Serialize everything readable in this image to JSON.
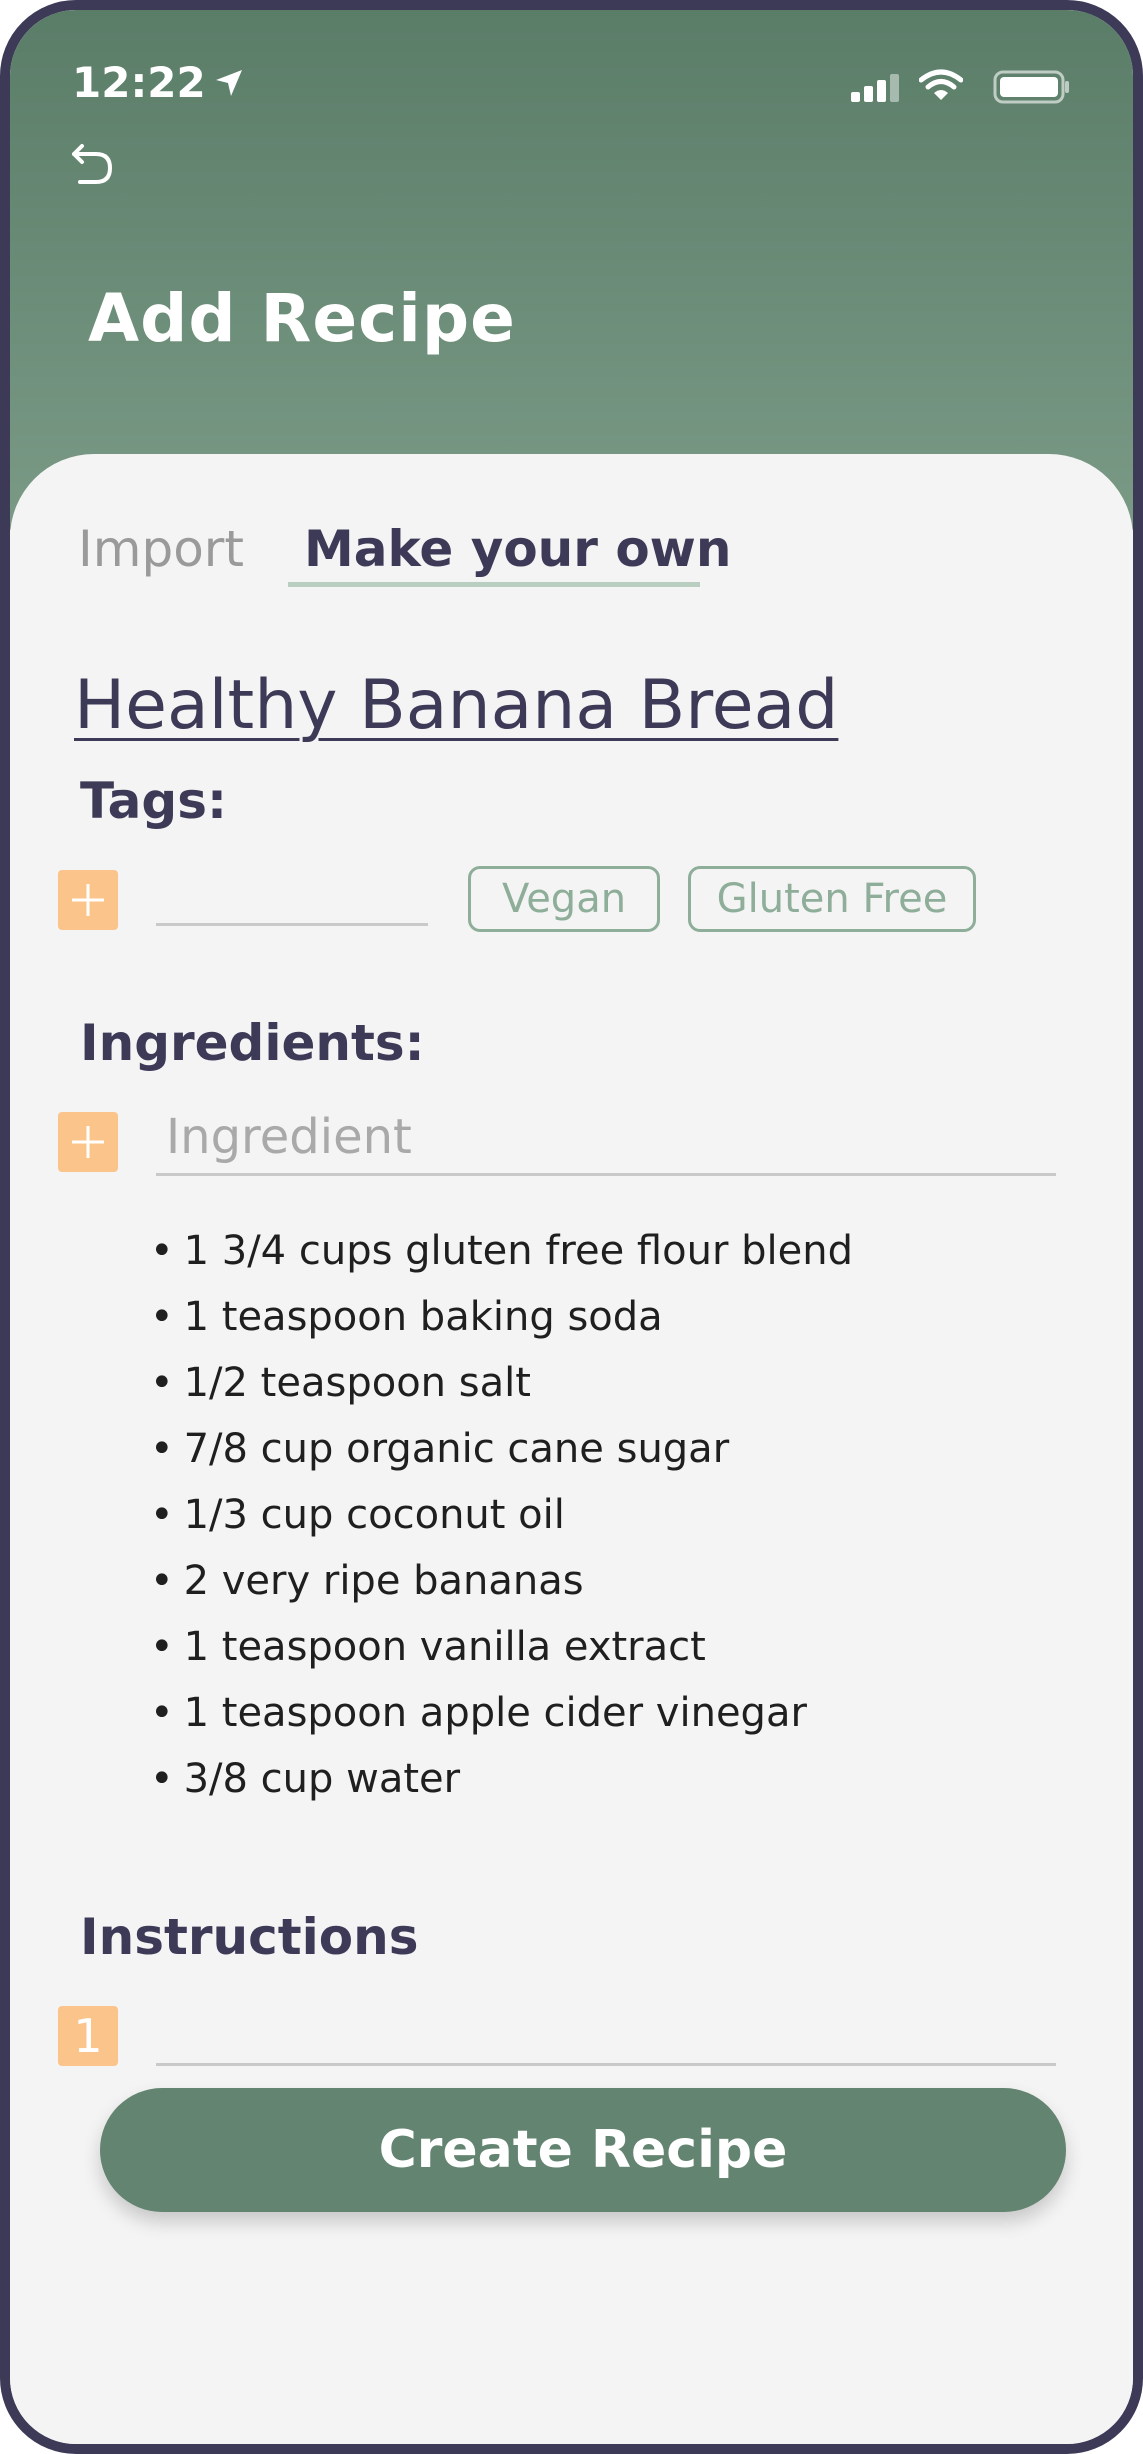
{
  "status_bar": {
    "time": "12:22"
  },
  "header": {
    "title": "Add Recipe"
  },
  "tabs": {
    "import": "Import",
    "make_your_own": "Make your own"
  },
  "recipe": {
    "name": "Healthy Banana Bread",
    "tags_label": "Tags:",
    "tags": [
      "Vegan",
      "Gluten Free"
    ],
    "ingredients_label": "Ingredients:",
    "ingredient_placeholder": "Ingredient",
    "ingredients": [
      "1 3/4 cups gluten free flour blend",
      "1 teaspoon baking soda",
      "1/2 teaspoon salt",
      "7/8 cup organic cane sugar",
      "1/3 cup coconut oil",
      "2 very ripe bananas",
      "1 teaspoon vanilla extract",
      "1 teaspoon apple cider vinegar",
      "3/8 cup water"
    ],
    "instructions_label": "Instructions",
    "instruction_step_number": "1"
  },
  "actions": {
    "create_label": "Create Recipe"
  },
  "colors": {
    "header_green": "#5a7d68",
    "button_green": "#638470",
    "accent_orange": "#fbc48a",
    "text_dark": "#3d3a57",
    "tag_green": "#8fae9a"
  },
  "icons": [
    "location-arrow-icon",
    "signal-icon",
    "wifi-icon",
    "battery-icon",
    "back-icon",
    "plus-icon"
  ]
}
